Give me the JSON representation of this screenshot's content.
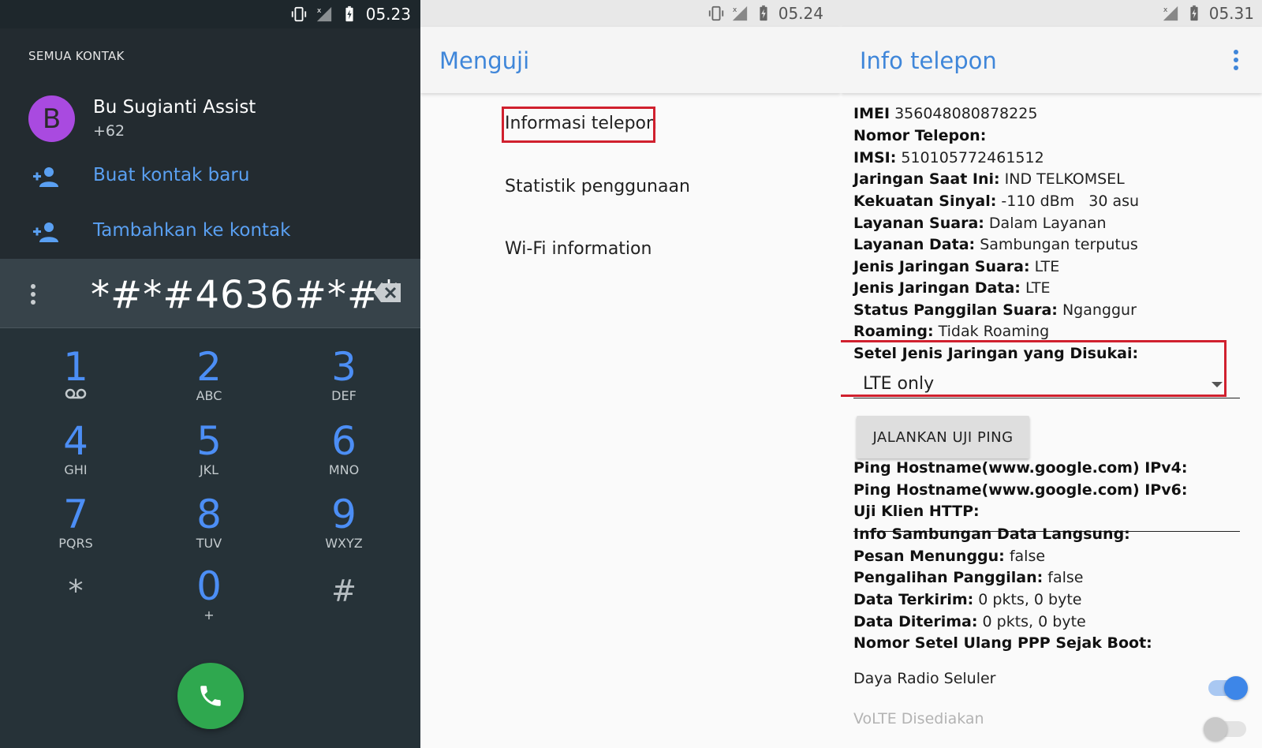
{
  "dialer": {
    "status_time": "05.23",
    "section_title": "SEMUA KONTAK",
    "contact": {
      "initial": "B",
      "name": "Bu Sugianti Assist",
      "number": "+62"
    },
    "actions": [
      "Buat kontak baru",
      "Tambahkan ke kontak"
    ],
    "dialed_number": "*#*#4636#*#*",
    "keys": [
      {
        "digit": "1",
        "letters": ""
      },
      {
        "digit": "2",
        "letters": "ABC"
      },
      {
        "digit": "3",
        "letters": "DEF"
      },
      {
        "digit": "4",
        "letters": "GHI"
      },
      {
        "digit": "5",
        "letters": "JKL"
      },
      {
        "digit": "6",
        "letters": "MNO"
      },
      {
        "digit": "7",
        "letters": "PQRS"
      },
      {
        "digit": "8",
        "letters": "TUV"
      },
      {
        "digit": "9",
        "letters": "WXYZ"
      },
      {
        "digit": "*",
        "letters": ""
      },
      {
        "digit": "0",
        "letters": "+"
      },
      {
        "digit": "#",
        "letters": ""
      }
    ],
    "colors": {
      "background": "#263238",
      "accent": "#4c8ef5",
      "call": "#2fa84f",
      "avatar": "#a94ae0"
    }
  },
  "testing": {
    "status_time": "05.24",
    "title": "Menguji",
    "items": [
      "Informasi telepon",
      "Statistik penggunaan",
      "Wi-Fi information"
    ]
  },
  "phone_info": {
    "status_time": "05.31",
    "title": "Info telepon",
    "rows": [
      {
        "label": "IMEI",
        "value": "356048080878225"
      },
      {
        "label": "Nomor Telepon:",
        "value": ""
      },
      {
        "label": "IMSI:",
        "value": "510105772461512"
      },
      {
        "label": "Jaringan Saat Ini:",
        "value": "IND TELKOMSEL"
      },
      {
        "label": "Kekuatan Sinyal:",
        "value": "-110 dBm   30 asu"
      },
      {
        "label": "Layanan Suara:",
        "value": "Dalam Layanan"
      },
      {
        "label": "Layanan Data:",
        "value": "Sambungan terputus"
      },
      {
        "label": "Jenis Jaringan Suara:",
        "value": "LTE"
      },
      {
        "label": "Jenis Jaringan Data:",
        "value": "LTE"
      },
      {
        "label": "Status Panggilan Suara:",
        "value": "Nganggur"
      },
      {
        "label": "Roaming:",
        "value": "Tidak Roaming"
      }
    ],
    "preferred_network_label": "Setel Jenis Jaringan yang Disukai:",
    "preferred_network_value": "LTE only",
    "ping_button": "JALANKAN UJI PING",
    "rows2": [
      {
        "label": "Ping Hostname(www.google.com) IPv4:",
        "value": ""
      },
      {
        "label": "Ping Hostname(www.google.com) IPv6:",
        "value": ""
      },
      {
        "label": "Uji Klien HTTP:",
        "value": ""
      }
    ],
    "rows3": [
      {
        "label": "Info Sambungan Data Langsung:",
        "value": ""
      },
      {
        "label": "Pesan Menunggu:",
        "value": "false"
      },
      {
        "label": "Pengalihan Panggilan:",
        "value": "false"
      },
      {
        "label": "Data Terkirim:",
        "value": "0 pkts, 0 byte"
      },
      {
        "label": "Data Diterima:",
        "value": "0 pkts, 0 byte"
      },
      {
        "label": "Nomor Setel Ulang PPP Sejak Boot:",
        "value": ""
      }
    ],
    "toggles": [
      {
        "label": "Daya Radio Seluler",
        "on": true
      },
      {
        "label": "VoLTE Disediakan",
        "on": false
      }
    ],
    "colors": {
      "title": "#3f86d9",
      "highlight": "#d0202e",
      "toggle_on": "#3d86e8"
    }
  }
}
